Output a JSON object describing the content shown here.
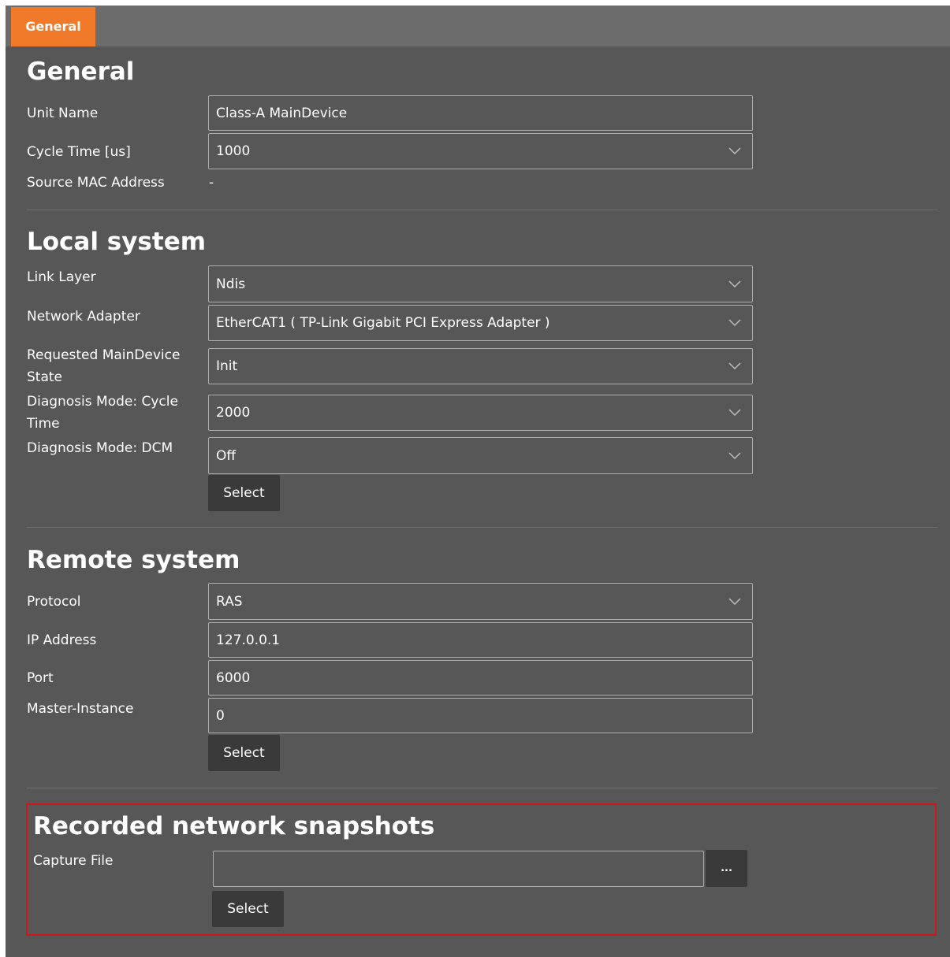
{
  "tabs": [
    {
      "label": "General",
      "active": true
    }
  ],
  "general": {
    "heading": "General",
    "unit_name": {
      "label": "Unit Name",
      "value": "Class-A MainDevice"
    },
    "cycle_time": {
      "label": "Cycle Time [us]",
      "value": "1000"
    },
    "source_mac": {
      "label": "Source MAC Address",
      "value": "-"
    }
  },
  "local_system": {
    "heading": "Local system",
    "link_layer": {
      "label": "Link Layer",
      "value": "Ndis"
    },
    "network_adapter": {
      "label": "Network Adapter",
      "value": "EtherCAT1 ( TP-Link Gigabit PCI Express Adapter )"
    },
    "requested_state": {
      "label_line1": "Requested MainDevice",
      "label_line2": "State",
      "value": "Init"
    },
    "diag_cycle_time": {
      "label_line1": "Diagnosis Mode: Cycle",
      "label_line2": "Time",
      "value": "2000"
    },
    "diag_dcm": {
      "label": "Diagnosis Mode: DCM",
      "value": "Off"
    },
    "select_label": "Select"
  },
  "remote_system": {
    "heading": "Remote system",
    "protocol": {
      "label": "Protocol",
      "value": "RAS"
    },
    "ip_address": {
      "label": "IP Address",
      "value": "127.0.0.1"
    },
    "port": {
      "label": "Port",
      "value": "6000"
    },
    "master_instance": {
      "label": "Master-Instance",
      "value": "0"
    },
    "select_label": "Select"
  },
  "snapshots": {
    "heading": "Recorded network snapshots",
    "capture_file": {
      "label": "Capture File",
      "value": ""
    },
    "browse_label": "...",
    "select_label": "Select"
  },
  "colors": {
    "accent": "#f07a2a",
    "panel": "#575757",
    "tabbar": "#6c6c6c",
    "highlight": "#d01616",
    "button": "#3a3a3a"
  },
  "icons": {
    "dropdown": "chevron-down-icon"
  }
}
